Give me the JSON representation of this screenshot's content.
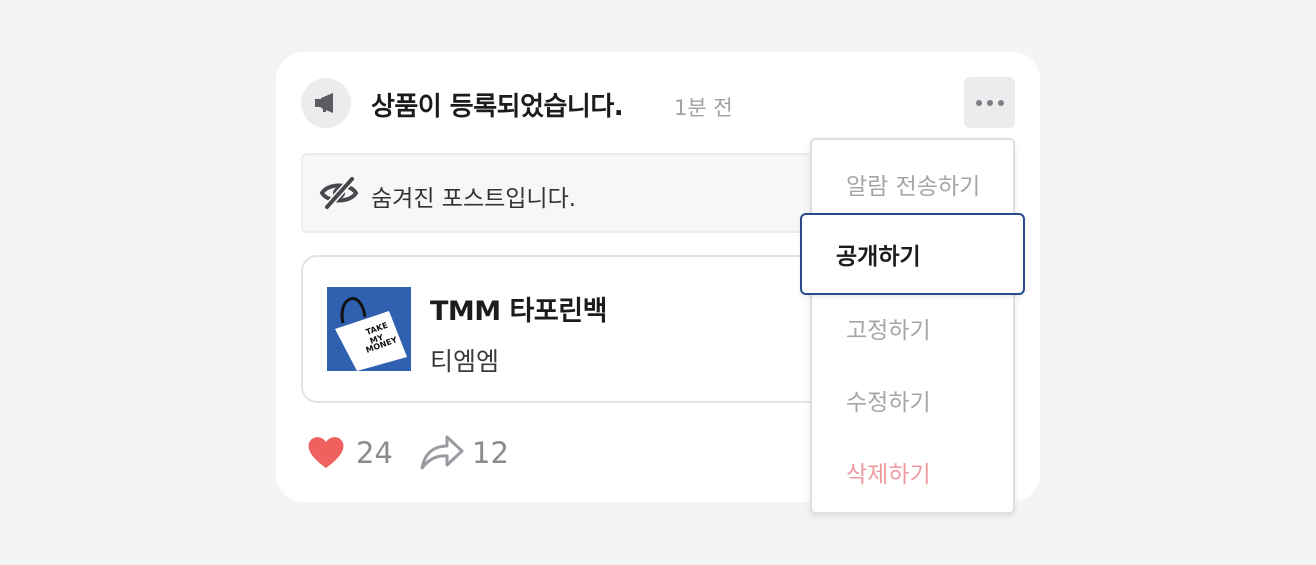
{
  "post": {
    "title": "상품이 등록되었습니다.",
    "time": "1분 전",
    "hidden_notice": "숨겨진 포스트입니다.",
    "product": {
      "name": "TMM 타포린백",
      "brand": "티엠엠",
      "thumb_text_lines": [
        "TAKE",
        "MY",
        "MONEY"
      ]
    },
    "likes": "24",
    "shares": "12"
  },
  "menu": {
    "items": [
      {
        "label": "알람 전송하기",
        "state": "normal"
      },
      {
        "label": "공개하기",
        "state": "focused"
      },
      {
        "label": "고정하기",
        "state": "normal"
      },
      {
        "label": "수정하기",
        "state": "normal"
      },
      {
        "label": "삭제하기",
        "state": "destructive"
      }
    ]
  },
  "icons": {
    "avatar": "megaphone-icon",
    "more": "more-horizontal-icon",
    "hidden": "eye-off-icon",
    "like": "heart-icon",
    "share": "share-arrow-icon"
  },
  "colors": {
    "accent_border": "#2a4a90",
    "like_heart": "#f0605f",
    "delete_text": "#ef9aa0",
    "thumb_bg": "#3060b0"
  }
}
